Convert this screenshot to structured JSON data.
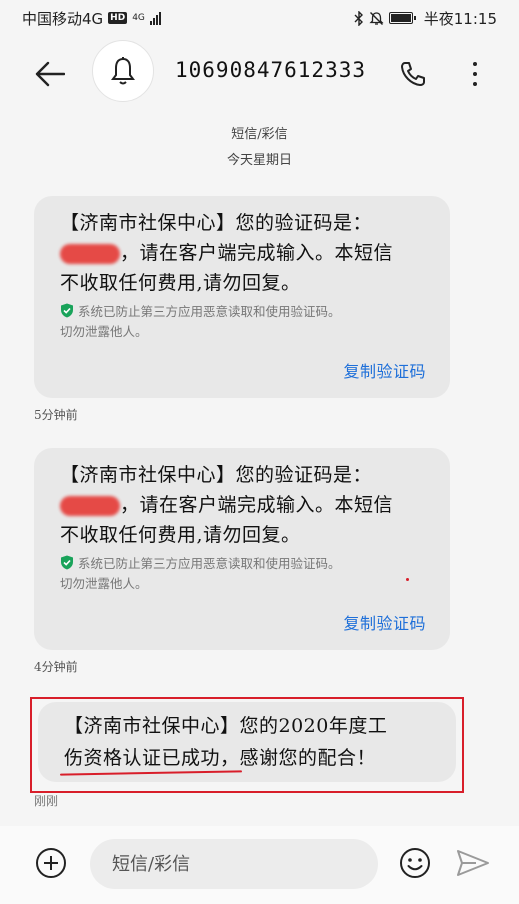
{
  "status_bar": {
    "carrier": "中国移动4G",
    "hd_badge": "HD",
    "network": "4G",
    "time": "半夜11:15",
    "icons": [
      "bluetooth-icon",
      "mute-icon",
      "battery-icon"
    ]
  },
  "header": {
    "phone_number": "10690847612333",
    "icons": [
      "back-arrow-icon",
      "bell-icon",
      "phone-icon",
      "more-vertical-icon"
    ]
  },
  "thread": {
    "type_label": "短信/彩信",
    "date_label": "今天星期日"
  },
  "messages": [
    {
      "line1": "【济南市社保中心】您的验证码是：",
      "line2_suffix": "，请在客户端完成输入。本短信",
      "line3": "不收取任何费用,请勿回复。",
      "security_note_1": "系统已防止第三方应用恶意读取和使用验证码。",
      "security_note_2": "切勿泄露他人。",
      "copy_label": "复制验证码",
      "time": "5分钟前"
    },
    {
      "line1": "【济南市社保中心】您的验证码是：",
      "line2_suffix": "，请在客户端完成输入。本短信",
      "line3": "不收取任何费用,请勿回复。",
      "security_note_1": "系统已防止第三方应用恶意读取和使用验证码。",
      "security_note_2": "切勿泄露他人。",
      "copy_label": "复制验证码",
      "time": "4分钟前"
    },
    {
      "line1": "【济南市社保中心】您的2020年度工",
      "line2": "伤资格认证已成功，感谢您的配合！",
      "time": "刚刚"
    }
  ],
  "composer": {
    "placeholder": "短信/彩信",
    "icons": [
      "add-icon",
      "emoji-icon",
      "send-icon"
    ]
  },
  "colors": {
    "link": "#1e6fd9",
    "shield": "#19a35a",
    "annotation": "#d81e2a",
    "bubble": "#e8e8e8"
  }
}
